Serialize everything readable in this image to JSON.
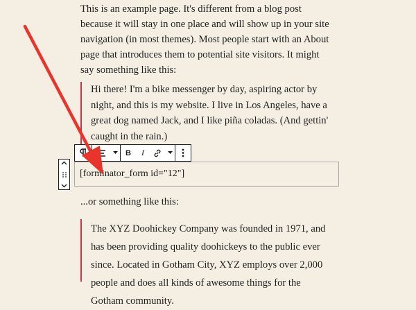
{
  "content": {
    "intro": "This is an example page. It's different from a blog post because it will stay in one place and will show up in your site navigation (in most themes). Most people start with an About page that introduces them to potential site visitors. It might say something like this:",
    "quote1": "Hi there! I'm a bike messenger by day, aspiring actor by night, and this is my website. I live in Los Angeles, have a great dog named Jack, and I like piña coladas. (And gettin' caught in the rain.)",
    "shortcode": "[forminator_form id=\"12\"]",
    "or_line": "...or something like this:",
    "quote2": "The XYZ Doohickey Company was founded in 1971, and has been providing quality doohickeys to the public ever since. Located in Gotham City, XYZ employs over 2,000 people and does all kinds of awesome things for the Gotham community."
  },
  "toolbar": {
    "buttons": [
      "paragraph-icon",
      "align-icon",
      "chevron-down-icon",
      "bold-icon",
      "italic-icon",
      "link-icon",
      "chevron-down-icon",
      "more-options-icon"
    ],
    "bold_label": "B",
    "italic_label": "I"
  },
  "mover": {
    "buttons": [
      "move-up-icon",
      "drag-handle-icon",
      "move-down-icon"
    ]
  },
  "annotation": {
    "arrow_color": "#e8342a"
  }
}
